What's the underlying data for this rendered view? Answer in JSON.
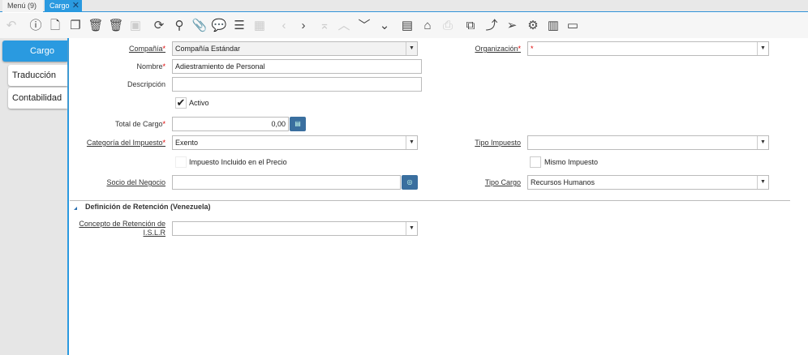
{
  "tabs": [
    {
      "label": "Menú (9)"
    },
    {
      "label": "Cargo"
    }
  ],
  "toolbar": [
    "undo",
    "help",
    "new",
    "copy",
    "delete",
    "delete-selection",
    "save",
    "refresh",
    "find",
    "attachment",
    "chat",
    "grid-toggle",
    "calendar",
    "previous",
    "next",
    "first",
    "parent",
    "detail",
    "last",
    "report",
    "archive",
    "print",
    "zoom-across",
    "workflow",
    "send",
    "process",
    "product-info",
    "export"
  ],
  "side_tabs": [
    {
      "label": "Cargo"
    },
    {
      "label": "Traducción"
    },
    {
      "label": "Contabilidad"
    }
  ],
  "form": {
    "company": {
      "label": "Compañía",
      "value": "Compañía Estándar"
    },
    "org": {
      "label": "Organización",
      "value": "*"
    },
    "name": {
      "label": "Nombre",
      "value": "Adiestramiento de Personal"
    },
    "description": {
      "label": "Descripción",
      "value": ""
    },
    "active": {
      "label": "Activo",
      "checked": true
    },
    "total": {
      "label": "Total de Cargo",
      "value": "0,00"
    },
    "tax_category": {
      "label": "Categoría del Impuesto",
      "value": "Exento"
    },
    "tax_type": {
      "label": "Tipo Impuesto",
      "value": ""
    },
    "tax_included": {
      "label": "Impuesto Incluido en el Precio",
      "checked": false
    },
    "same_tax": {
      "label": "Mismo Impuesto",
      "checked": false
    },
    "bpartner": {
      "label": "Socio del Negocio",
      "value": ""
    },
    "charge_type": {
      "label": "Tipo Cargo",
      "value": "Recursos Humanos"
    }
  },
  "section": {
    "title": "Definición de Retención (Venezuela)",
    "concept_label1": "Concepto de Retención de",
    "concept_label2": "I.S.L.R",
    "concept_value": ""
  },
  "required_mark": "*",
  "colors": {
    "accent": "#2a9ae0",
    "button": "#3a6f9f"
  }
}
